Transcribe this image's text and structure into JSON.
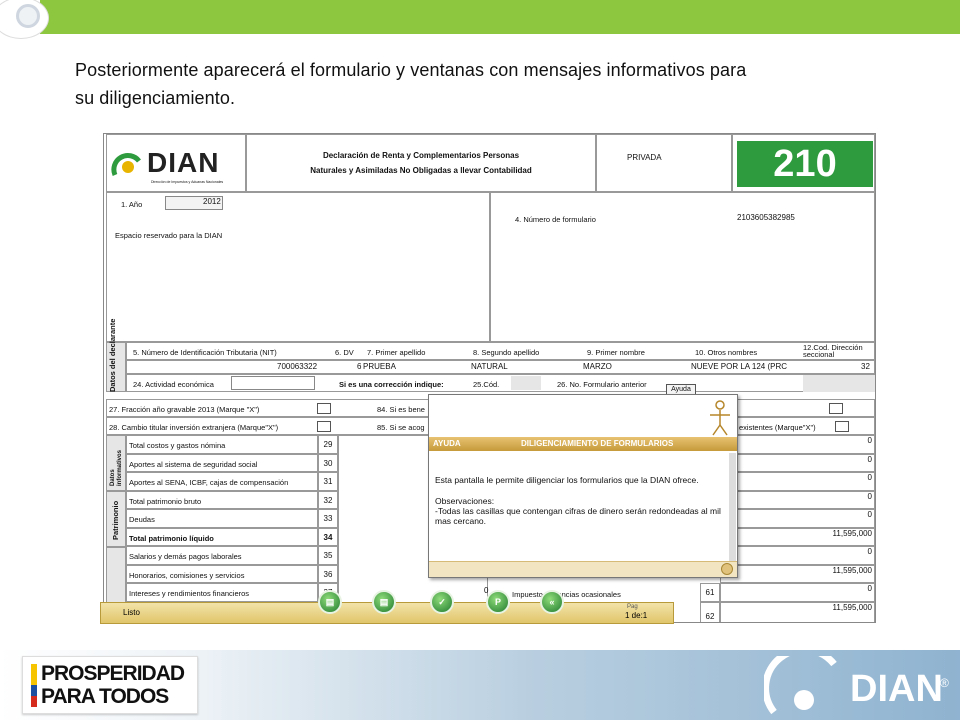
{
  "intro": {
    "line1": "Posteriormente aparecerá el formulario y ventanas con mensajes informativos para",
    "line2": "su diligenciamiento."
  },
  "form": {
    "logo_text": "DIAN",
    "logo_sub": "Dirección de Impuestos y Aduanas Nacionales",
    "title_line1": "Declaración de Renta y Complementarios Personas",
    "title_line2": "Naturales y Asimiladas No Obligadas a llevar Contabilidad",
    "privada": "PRIVADA",
    "form_number": "210",
    "anio_label": "1. Año",
    "anio_value": "2012",
    "espacio_label": "Espacio reservado para la DIAN",
    "numero_form_label": "4. Número de formulario",
    "numero_form_value": "2103605382985",
    "declarante_label": "Datos del declarante",
    "nit_label": "5. Número de Identificación Tributaria (NIT)",
    "dv_label": "6. DV",
    "primer_apellido_label": "7. Primer apellido",
    "segundo_apellido_label": "8. Segundo apellido",
    "primer_nombre_label": "9. Primer nombre",
    "otros_nombres_label": "10. Otros nombres",
    "cod_dir_label": "12.Cod. Dirección seccional",
    "nit_value": "700063322",
    "dv_value": "6",
    "primer_apellido_value": "PRUEBA",
    "segundo_apellido_value": "NATURAL",
    "primer_nombre_value": "MARZO",
    "otros_nombres_value": "NUEVE POR LA 124 (PRC",
    "cod_dir_value": "32",
    "actividad_label": "24. Actividad económica",
    "correccion_label": "Si es una corrección indique:",
    "cod25_label": "25.Cód.",
    "form_anterior_label": "26. No. Formulario anterior",
    "ayuda_btn": "Ayuda",
    "r27_label": "27. Fracción año gravable 2013 (Marque \"X\")",
    "r28_label": "28. Cambio titular inversión extranjera (Marque\"X\")",
    "r84_label": "84. Si es bene",
    "r85_label": "85. Si se acog",
    "existentes_label": "existentes (Marque\"X\")",
    "datos_info_label": "Datos informativos",
    "patrimonio_label": "Patrimonio",
    "rows": [
      {
        "label": "Total costos y gastos nómina",
        "num": "29",
        "bold": false
      },
      {
        "label": "Aportes al sistema de seguridad social",
        "num": "30",
        "bold": false
      },
      {
        "label": "Aportes al SENA, ICBF, cajas de compensación",
        "num": "31",
        "bold": false
      },
      {
        "label": "Total patrimonio bruto",
        "num": "32",
        "bold": false
      },
      {
        "label": "Deudas",
        "num": "33",
        "bold": false
      },
      {
        "label": "Total patrimonio líquido",
        "num": "34",
        "bold": true
      },
      {
        "label": "Salarios y demás pagos laborales",
        "num": "35",
        "bold": false
      },
      {
        "label": "Honorarios, comisiones y servicios",
        "num": "36",
        "bold": false
      },
      {
        "label": "Intereses y rendimientos financieros",
        "num": "37",
        "bold": false
      }
    ],
    "right_values": [
      "0",
      "0",
      "0",
      "0",
      "0",
      "11,595,000",
      "0",
      "11,595,000",
      "0",
      "11,595,000"
    ],
    "row61_label": "Impuesto ganancias ocasionales",
    "row61_num": "61",
    "row62_num": "62",
    "zero_small": "0"
  },
  "popup": {
    "ayuda_title": "AYUDA",
    "bar_title": "DILIGENCIAMIENTO DE FORMULARIOS",
    "text1": "Esta pantalla le permite diligenciar los formularios que la DIAN ofrece.",
    "obs_title": "Observaciones:",
    "obs_text": "-Todas las casillas que contengan cifras de dinero serán redondeadas al mil mas cercano."
  },
  "status": {
    "listo": "Listo",
    "pag_label": "Pag",
    "pag_value": "1 de:1"
  },
  "footer": {
    "prosp_line1": "PROSPERIDAD",
    "prosp_line2": "PARA TODOS",
    "dian": "DIAN",
    "reg": "®"
  },
  "colors": {
    "topbar": "#8dc63f",
    "form_green": "#2e9b3e",
    "popup_bar": "#d2a84c"
  }
}
